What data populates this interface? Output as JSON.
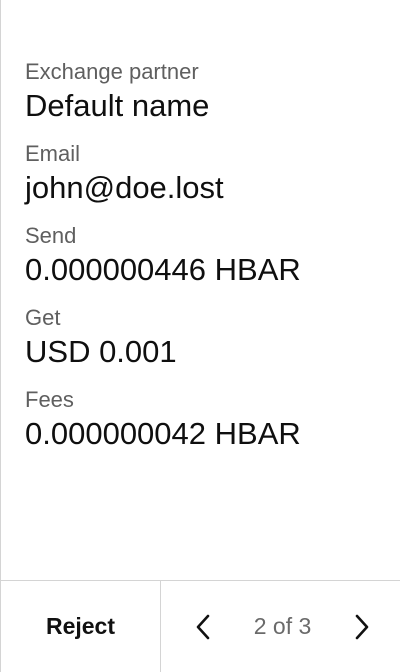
{
  "details": [
    {
      "label": "Exchange partner",
      "value": "Default name"
    },
    {
      "label": "Email",
      "value": "john@doe.lost"
    },
    {
      "label": "Send",
      "value": "0.000000446 HBAR"
    },
    {
      "label": "Get",
      "value": "USD 0.001"
    },
    {
      "label": "Fees",
      "value": "0.000000042 HBAR"
    }
  ],
  "footer": {
    "reject_label": "Reject",
    "page_indicator": "2 of 3",
    "prev_icon": "chevron-left-icon",
    "next_icon": "chevron-right-icon"
  }
}
